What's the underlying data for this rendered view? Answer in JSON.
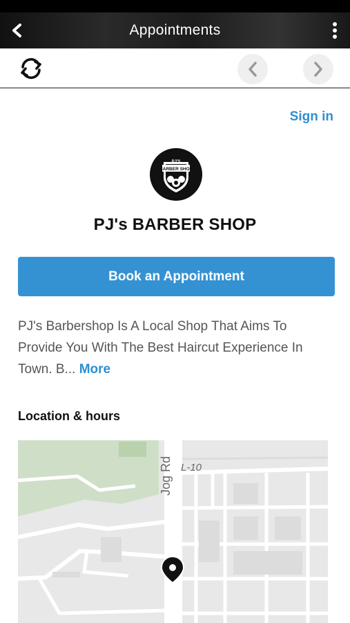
{
  "header": {
    "title": "Appointments",
    "back_icon": "back-arrow-icon",
    "more_icon": "more-vertical-icon"
  },
  "toolbar": {
    "refresh_icon": "refresh-icon",
    "prev_icon": "chevron-left-icon",
    "next_icon": "chevron-right-icon"
  },
  "signin": {
    "label": "Sign in"
  },
  "business": {
    "name": "PJ's BARBER SHOP",
    "logo_top": "PJ'S",
    "logo_main": "BARBER SHOP"
  },
  "book_button": {
    "label": "Book an Appointment"
  },
  "description": {
    "text": "PJ's Barbershop Is A Local Shop That Aims To Provide You With The Best Haircut Experience In Town. B...",
    "more_label": "More"
  },
  "location": {
    "title": "Location & hours",
    "map": {
      "road_labels": [
        "Jog Rd",
        "L-10"
      ],
      "pin_icon": "map-pin-icon"
    }
  },
  "colors": {
    "accent": "#3592d2",
    "link": "#2e8fce",
    "appbar": "#1d1d1d"
  }
}
